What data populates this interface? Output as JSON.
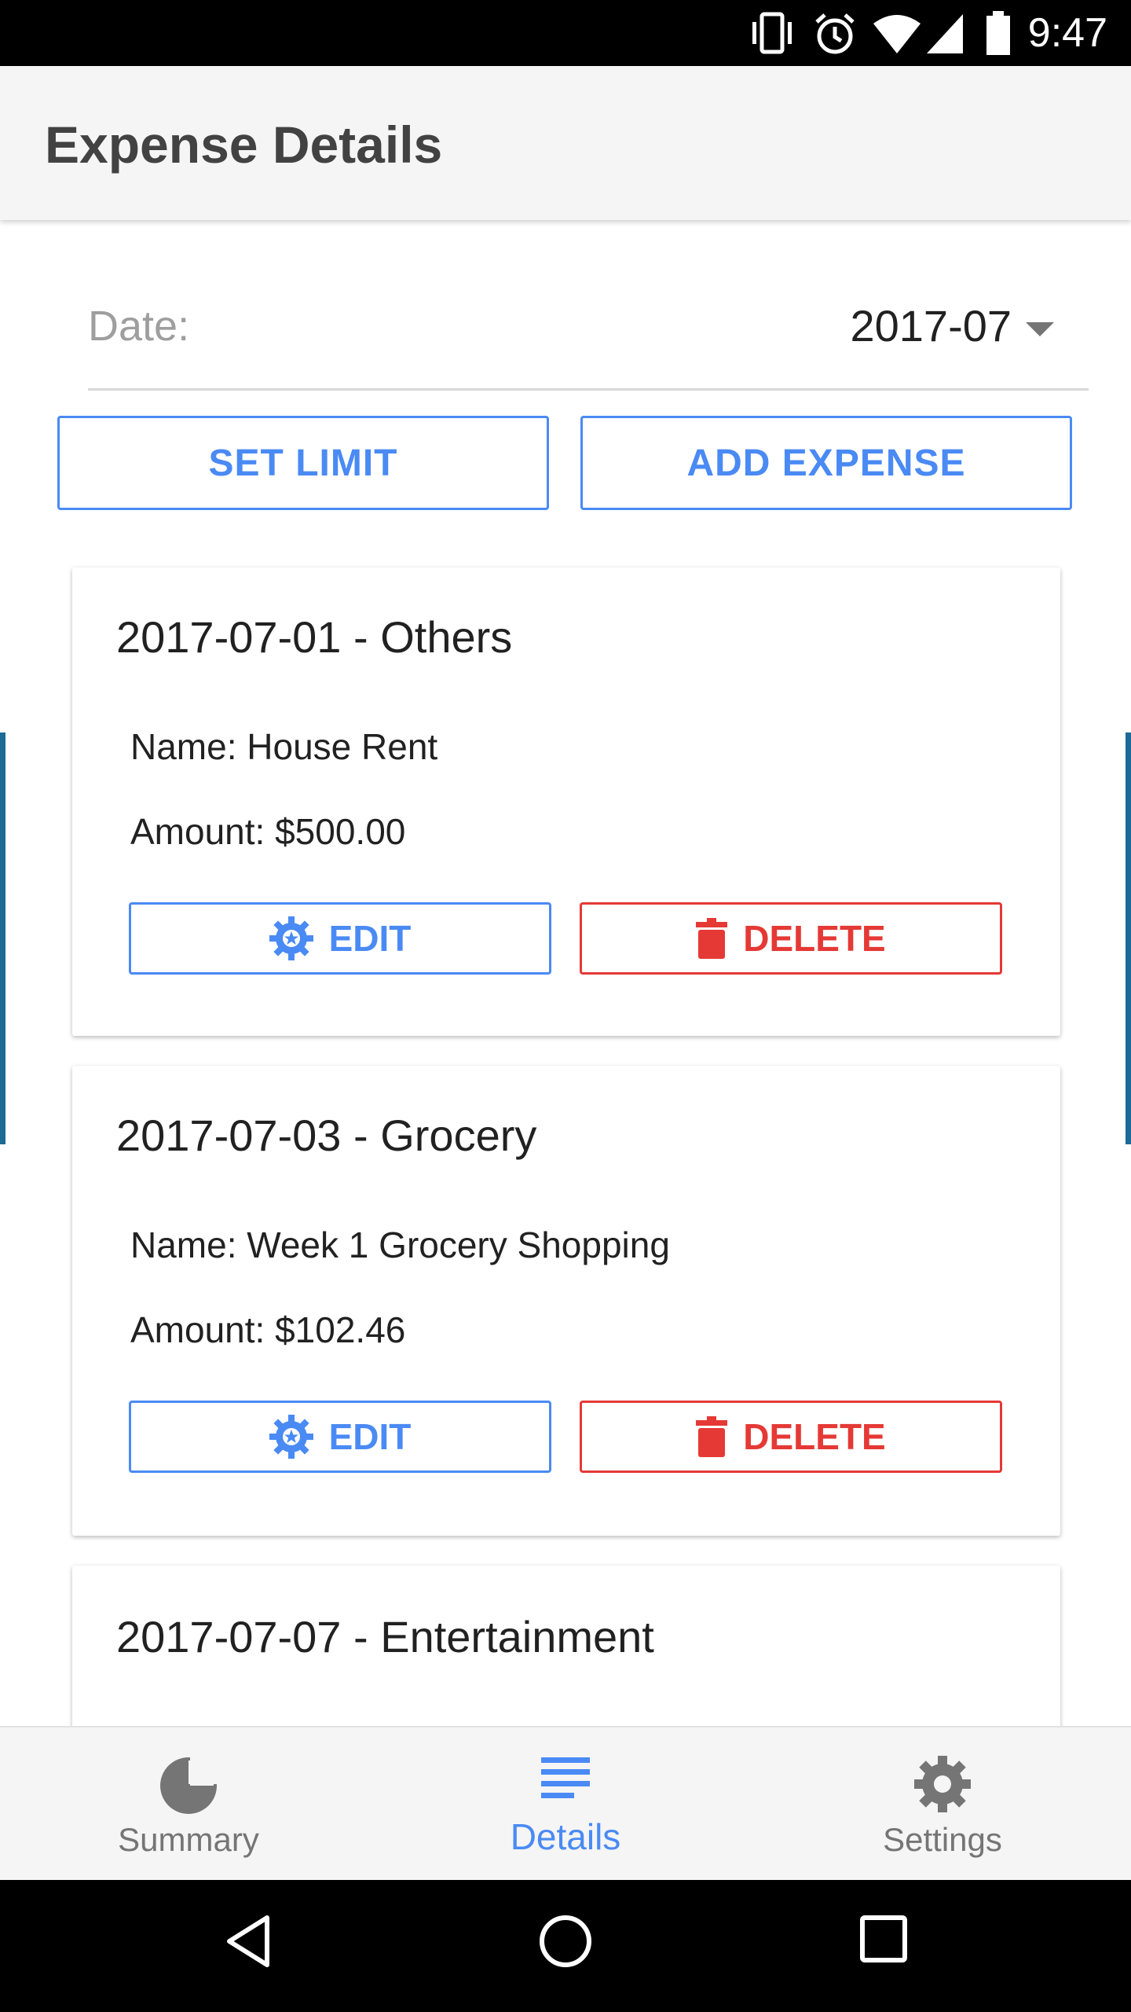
{
  "status_bar": {
    "time": "9:47",
    "icons": [
      "vibrate-icon",
      "alarm-icon",
      "wifi-icon",
      "signal-icon",
      "battery-icon"
    ]
  },
  "app_bar": {
    "title": "Expense Details"
  },
  "date_picker": {
    "label": "Date:",
    "value": "2017-07"
  },
  "actions": {
    "set_limit": "SET LIMIT",
    "add_expense": "ADD EXPENSE"
  },
  "expenses": [
    {
      "title": "2017-07-01 - Others",
      "name": "Name: House Rent",
      "amount": "Amount: $500.00",
      "edit_label": "EDIT",
      "delete_label": "DELETE"
    },
    {
      "title": "2017-07-03 - Grocery",
      "name": "Name: Week 1 Grocery Shopping",
      "amount": "Amount: $102.46",
      "edit_label": "EDIT",
      "delete_label": "DELETE"
    },
    {
      "title": "2017-07-07 - Entertainment"
    }
  ],
  "bottom_nav": {
    "items": [
      {
        "label": "Summary",
        "icon": "pie-chart-icon",
        "active": false
      },
      {
        "label": "Details",
        "icon": "list-icon",
        "active": true
      },
      {
        "label": "Settings",
        "icon": "gear-icon",
        "active": false
      }
    ]
  },
  "colors": {
    "accent": "#4a8af4",
    "danger": "#e53935",
    "inactive": "#757575",
    "edge_accent": "#1e6a96"
  }
}
